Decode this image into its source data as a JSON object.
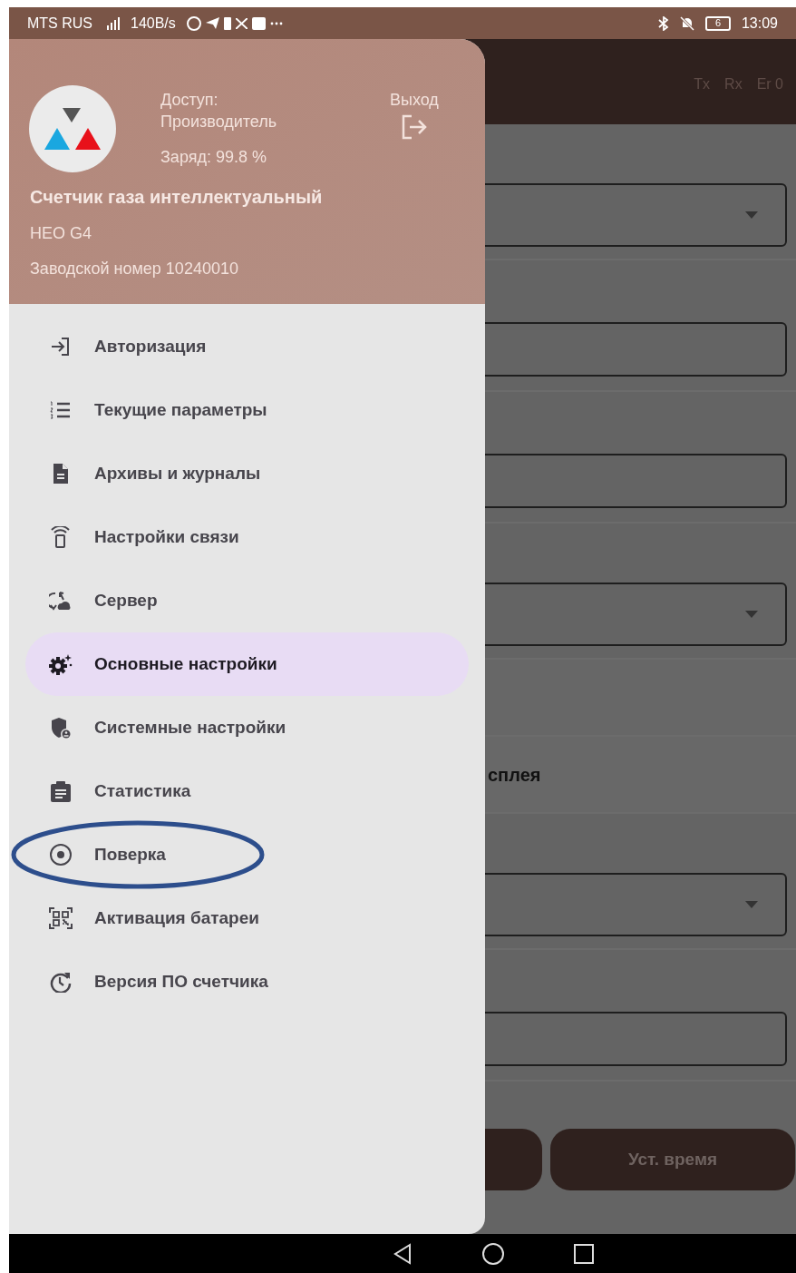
{
  "status_bar": {
    "carrier": "MTS RUS",
    "speed": "140B/s",
    "battery": "6",
    "time": "13:09"
  },
  "app_bar": {
    "tx": "Tx",
    "rx": "Rx",
    "er": "Er 0"
  },
  "form_rows": [
    {
      "kind": "dropdown"
    },
    {
      "kind": "input"
    },
    {
      "kind": "input"
    },
    {
      "kind": "dropdown"
    },
    {
      "kind": "empty"
    },
    {
      "kind": "section",
      "text": "сплея"
    },
    {
      "kind": "dropdown"
    },
    {
      "kind": "input"
    }
  ],
  "buttons": [
    {
      "kind": "blank"
    },
    {
      "kind": "labeled",
      "label": "Уст. время"
    }
  ],
  "drawer": {
    "header": {
      "access_label": "Доступ:",
      "access_value": "Производитель",
      "charge": "Заряд: 99.8 %",
      "logout": "Выход",
      "device_name": "Счетчик газа интеллектуальный",
      "model": "HEO G4",
      "serial": "Заводской номер 10240010"
    },
    "items": [
      {
        "label": "Авторизация",
        "selected": false,
        "circled": false
      },
      {
        "label": "Текущие параметры",
        "selected": false,
        "circled": false
      },
      {
        "label": "Архивы и журналы",
        "selected": false,
        "circled": false
      },
      {
        "label": "Настройки связи",
        "selected": false,
        "circled": false
      },
      {
        "label": "Сервер",
        "selected": false,
        "circled": false
      },
      {
        "label": "Основные настройки",
        "selected": true,
        "circled": false
      },
      {
        "label": "Системные настройки",
        "selected": false,
        "circled": false
      },
      {
        "label": "Статистика",
        "selected": false,
        "circled": false
      },
      {
        "label": "Поверка",
        "selected": false,
        "circled": true
      },
      {
        "label": "Активация батареи",
        "selected": false,
        "circled": false
      },
      {
        "label": "Версия ПО счетчика",
        "selected": false,
        "circled": false
      }
    ]
  }
}
